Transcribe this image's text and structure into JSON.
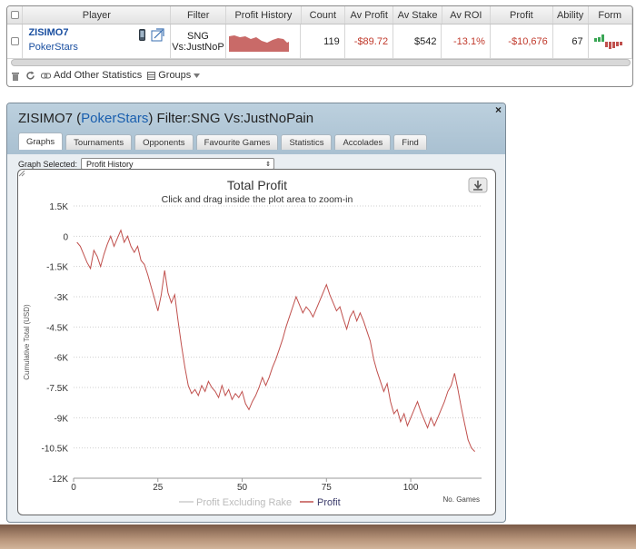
{
  "stats_table": {
    "headers": [
      "Player",
      "Filter",
      "Profit History",
      "Count",
      "Av Profit",
      "Av Stake",
      "Av ROI",
      "Profit",
      "Ability",
      "Form"
    ],
    "row": {
      "player_name": "ZISIMO7",
      "player_site": "PokerStars",
      "filter_line1": "SNG",
      "filter_line2": "Vs:JustNoP",
      "count": "119",
      "av_profit": "-$89.72",
      "av_stake": "$542",
      "av_roi": "-13.1%",
      "profit": "-$10,676",
      "ability": "67",
      "remove_link": "x"
    },
    "toolbar": {
      "add_other_statistics": "Add Other Statistics",
      "groups": "Groups"
    }
  },
  "popup": {
    "title_player": "ZISIMO7 (",
    "title_site": "PokerStars",
    "title_rest": ") Filter:SNG Vs:JustNoPain",
    "close": "×",
    "tabs": [
      "Graphs",
      "Tournaments",
      "Opponents",
      "Favourite Games",
      "Statistics",
      "Accolades",
      "Find"
    ],
    "active_tab": "Graphs",
    "graph_selected_label": "Graph Selected:",
    "graph_selected_value": "Profit History",
    "graph_selected_arrow": "⇕"
  },
  "colors": {
    "profit_line": "#c0504d",
    "negative_text": "#c0392b",
    "link": "#1a4fa0",
    "excl_rake_line": "#cccccc"
  },
  "chart_data": {
    "type": "line",
    "title": "Total Profit",
    "subtitle": "Click and drag inside the plot area to zoom-in",
    "xlabel": "No. Games",
    "ylabel": "Cumulative Total (USD)",
    "xlim": [
      0,
      121
    ],
    "ylim": [
      -12000,
      1500
    ],
    "x_ticks": [
      0,
      25,
      50,
      75,
      100
    ],
    "y_ticks": [
      1500,
      0,
      -1500,
      -3000,
      -4500,
      -6000,
      -7500,
      -9000,
      -10500,
      -12000
    ],
    "y_tick_labels": [
      "1.5K",
      "0",
      "-1.5K",
      "-3K",
      "-4.5K",
      "-6K",
      "-7.5K",
      "-9K",
      "-10.5K",
      "-12K"
    ],
    "legend": [
      "Profit Excluding Rake",
      "Profit"
    ],
    "series": [
      {
        "name": "Profit",
        "x": [
          1,
          2,
          3,
          4,
          5,
          6,
          7,
          8,
          9,
          10,
          11,
          12,
          13,
          14,
          15,
          16,
          17,
          18,
          19,
          20,
          21,
          22,
          23,
          24,
          25,
          26,
          27,
          28,
          29,
          30,
          31,
          32,
          33,
          34,
          35,
          36,
          37,
          38,
          39,
          40,
          41,
          42,
          43,
          44,
          45,
          46,
          47,
          48,
          49,
          50,
          51,
          52,
          53,
          54,
          55,
          56,
          57,
          58,
          59,
          60,
          61,
          62,
          63,
          64,
          65,
          66,
          67,
          68,
          69,
          70,
          71,
          72,
          73,
          74,
          75,
          76,
          77,
          78,
          79,
          80,
          81,
          82,
          83,
          84,
          85,
          86,
          87,
          88,
          89,
          90,
          91,
          92,
          93,
          94,
          95,
          96,
          97,
          98,
          99,
          100,
          101,
          102,
          103,
          104,
          105,
          106,
          107,
          108,
          109,
          110,
          111,
          112,
          113,
          114,
          115,
          116,
          117,
          118,
          119
        ],
        "y": [
          -300,
          -500,
          -900,
          -1300,
          -1600,
          -700,
          -1000,
          -1500,
          -900,
          -400,
          0,
          -500,
          -100,
          300,
          -300,
          0,
          -500,
          -800,
          -500,
          -1200,
          -1400,
          -1900,
          -2500,
          -3100,
          -3700,
          -2900,
          -1700,
          -2800,
          -3300,
          -2900,
          -4200,
          -5400,
          -6500,
          -7400,
          -7800,
          -7600,
          -7900,
          -7400,
          -7700,
          -7200,
          -7500,
          -7700,
          -8000,
          -7400,
          -7900,
          -7600,
          -8100,
          -7800,
          -8000,
          -7700,
          -8300,
          -8600,
          -8200,
          -7900,
          -7500,
          -7000,
          -7400,
          -7000,
          -6500,
          -6100,
          -5600,
          -5100,
          -4500,
          -4000,
          -3500,
          -3000,
          -3400,
          -3800,
          -3500,
          -3700,
          -4000,
          -3600,
          -3200,
          -2800,
          -2400,
          -2900,
          -3300,
          -3700,
          -3500,
          -4100,
          -4600,
          -4000,
          -3700,
          -4200,
          -3800,
          -4200,
          -4700,
          -5200,
          -6100,
          -6700,
          -7200,
          -7700,
          -7300,
          -8200,
          -8800,
          -8600,
          -9200,
          -8800,
          -9400,
          -9000,
          -8600,
          -8200,
          -8700,
          -9100,
          -9500,
          -9000,
          -9400,
          -9000,
          -8600,
          -8200,
          -7700,
          -7400,
          -6800,
          -7600,
          -8500,
          -9300,
          -10100,
          -10500,
          -10676
        ]
      },
      {
        "name": "Profit Excluding Rake",
        "x": [],
        "y": []
      }
    ]
  }
}
